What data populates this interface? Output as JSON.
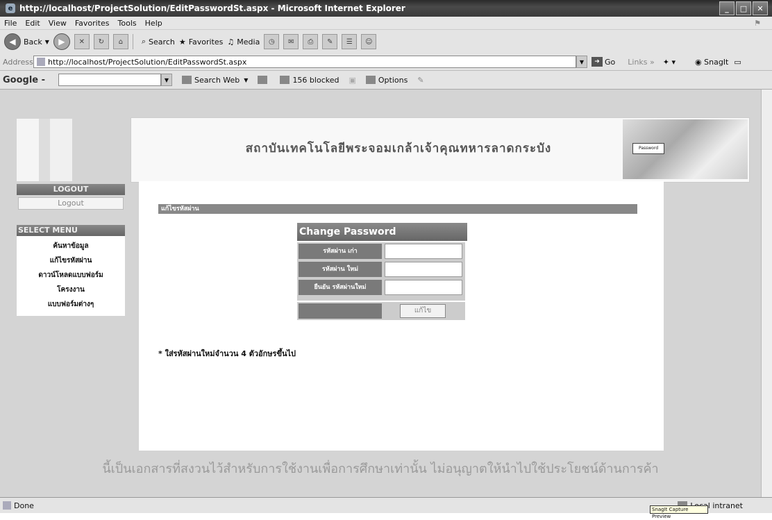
{
  "window": {
    "title": "http://localhost/ProjectSolution/EditPasswordSt.aspx - Microsoft Internet Explorer"
  },
  "menubar": [
    "File",
    "Edit",
    "View",
    "Favorites",
    "Tools",
    "Help"
  ],
  "toolbar": {
    "back": "Back",
    "search": "Search",
    "favorites": "Favorites",
    "media": "Media"
  },
  "addressbar": {
    "label": "Address",
    "url": "http://localhost/ProjectSolution/EditPasswordSt.aspx",
    "go": "Go",
    "links": "Links",
    "snagit": "SnagIt"
  },
  "googlebar": {
    "logo": "Google -",
    "search_web": "Search Web",
    "blocked": "156 blocked",
    "options": "Options"
  },
  "page": {
    "banner_text": "สถาบันเทคโนโลยีพระจอมเกล้าเจ้าคุณทหารลาดกระบัง",
    "banner_image_text": "Password",
    "sidebar": {
      "logout_header": "LOGOUT",
      "logout_link": "Logout",
      "menu_header": "SELECT MENU",
      "items": [
        "ค้นหาข้อมูล",
        "แก้ไขรหัสผ่าน",
        "ดาวน์โหลดแบบฟอร์ม",
        "โครงงาน",
        "แบบฟอร์มต่างๆ"
      ]
    },
    "breadcrumb": "แก้ไขรหัสผ่าน",
    "change_password": {
      "title": "Change Password",
      "old_label": "รหัสผ่าน เก่า",
      "new_label": "รหัสผ่าน ใหม่",
      "confirm_label": "ยืนยัน รหัสผ่านใหม่",
      "submit": "แก้ไข"
    },
    "note": "* ใส่รหัสผ่านใหม่จำนวน 4 ตัวอักษรขึ้นไป",
    "watermark": "นี้เป็นเอกสารที่สงวนไว้สำหรับการใช้งานเพื่อการศึกษาเท่านั้น ไม่อนุญาตให้นำไปใช้ประโยชน์ด้านการค้า"
  },
  "statusbar": {
    "status": "Done",
    "zone": "Local intranet",
    "tooltip": "SnagIt Capture Preview"
  }
}
